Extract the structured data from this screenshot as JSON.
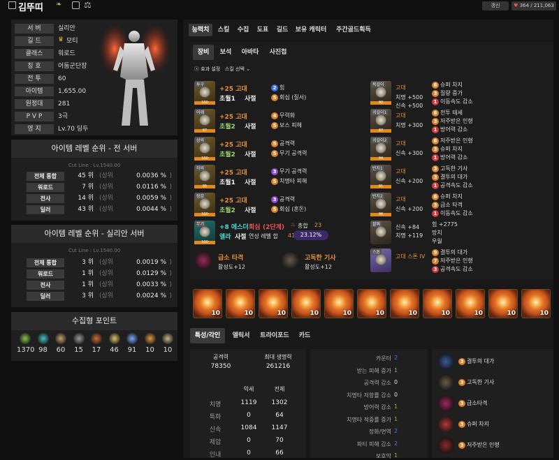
{
  "header": {
    "name": "김뚜띠",
    "update_label": "갱신",
    "likes": "364 / 211,063"
  },
  "profile": {
    "rows": [
      {
        "label": "서 버",
        "value": "실리안"
      },
      {
        "label": "길 드",
        "value": "모티"
      },
      {
        "label": "클래스",
        "value": "워로드"
      },
      {
        "label": "칭 호",
        "value": "어둠군단장"
      },
      {
        "label": "전 투",
        "value": "60"
      },
      {
        "label": "아이템",
        "value": "1,655.00"
      },
      {
        "label": "원정대",
        "value": "281"
      },
      {
        "label": "P V P",
        "value": "3극"
      },
      {
        "label": "영 지",
        "value": "Lv.70 딩두"
      }
    ]
  },
  "rank_all": {
    "title": "아이템 레벨 순위 - 전 서버",
    "cutline": "Cut Line : Lv.1540.00",
    "rows": [
      {
        "label": "전체 통합",
        "rank": "45 위",
        "pct": "0.0036 %"
      },
      {
        "label": "워로드",
        "rank": "7 위",
        "pct": "0.0116 %"
      },
      {
        "label": "전사",
        "rank": "14 위",
        "pct": "0.0059 %"
      },
      {
        "label": "딜러",
        "rank": "43 위",
        "pct": "0.0044 %"
      }
    ]
  },
  "rank_server": {
    "title": "아이템 레벨 순위 - 실리안 서버",
    "cutline": "Cut Line : Lv.1540.00",
    "rows": [
      {
        "label": "전체 통합",
        "rank": "3 위",
        "pct": "0.0019 %"
      },
      {
        "label": "워로드",
        "rank": "1 위",
        "pct": "0.0129 %"
      },
      {
        "label": "전사",
        "rank": "1 위",
        "pct": "0.0033 %"
      },
      {
        "label": "딜러",
        "rank": "3 위",
        "pct": "0.0024 %"
      }
    ]
  },
  "rank_labels": {
    "upper": "(상위",
    "close": ")"
  },
  "collect": {
    "title": "수집형 포인트",
    "values": [
      "1370",
      "98",
      "60",
      "15",
      "17",
      "46",
      "91",
      "10",
      "10"
    ]
  },
  "tabs_main": [
    "능력치",
    "스킬",
    "수집",
    "도표",
    "길드",
    "보유 캐릭터",
    "주간골드획득"
  ],
  "tabs_equip": [
    "장비",
    "보석",
    "아바타",
    "사진첩"
  ],
  "equip_options": {
    "effect": "효과 설정",
    "skill_select": "스킬 선택"
  },
  "armor": [
    {
      "cat": "투구",
      "q": "100",
      "grade": "+25 고대",
      "elixir_grade": "초월1",
      "elixir": "사절",
      "s1n": "2",
      "s1": "힘",
      "s2n": "5",
      "s2": "회심 (질서)"
    },
    {
      "cat": "어깨",
      "q": "97",
      "grade": "+25 고대",
      "elixir_grade": "초월2",
      "elixir": "사절",
      "s1n": "4",
      "s1": "무력화",
      "s2n": "5",
      "s2": "보스 피해"
    },
    {
      "cat": "상의",
      "q": "100",
      "grade": "+25 고대",
      "elixir_grade": "초월2",
      "elixir": "사절",
      "s1n": "5",
      "s1": "공격력",
      "s2n": "5",
      "s2": "무기 공격력"
    },
    {
      "cat": "하의",
      "q": "95",
      "grade": "+25 고대",
      "elixir_grade": "초월1",
      "elixir": "사절",
      "s1n": "3",
      "s1": "무기 공격력",
      "s2n": "5",
      "s2": "치명타 피해"
    },
    {
      "cat": "장갑",
      "q": "100",
      "grade": "+25 고대",
      "elixir_grade": "초월2",
      "elixir": "사절",
      "s1n": "3",
      "s1": "공격력",
      "s2n": "5",
      "s2": "회심 (혼돈)"
    }
  ],
  "weapon": {
    "cat": "무기",
    "q": "100",
    "grade": "+8 에스더",
    "name": "엘라",
    "name_suffix": "사절",
    "crit_label": "회심",
    "crit_stage": "(2단계)",
    "total_label": "총합",
    "total": "23",
    "yeon_label": "연성 레벨 합",
    "yeon": "41",
    "pct": "23.12%"
  },
  "engr_featured": [
    {
      "name": "급소 타격",
      "level": "활성도+12"
    },
    {
      "name": "고독한 기사",
      "level": "활성도+12"
    }
  ],
  "acc": [
    {
      "cat": "목걸이",
      "q": "90",
      "grade": "고대",
      "stats": [
        "치명 +500",
        "신속 +500"
      ],
      "effects": [
        {
          "n": "6",
          "t": "슈퍼 차지"
        },
        {
          "n": "3",
          "t": "질량 증가"
        },
        {
          "n": "1",
          "t": "이동속도 감소"
        }
      ]
    },
    {
      "cat": "귀걸이1",
      "q": "87",
      "grade": "고대",
      "stats": [
        "치명 +300"
      ],
      "effects": [
        {
          "n": "6",
          "t": "전투 태세"
        },
        {
          "n": "3",
          "t": "저주받은 인형"
        },
        {
          "n": "1",
          "t": "방어력 감소"
        }
      ]
    },
    {
      "cat": "귀걸이2",
      "q": "94",
      "grade": "고대",
      "stats": [
        "신속 +300"
      ],
      "effects": [
        {
          "n": "6",
          "t": "저주받은 인형"
        },
        {
          "n": "3",
          "t": "슈퍼 차지"
        },
        {
          "n": "1",
          "t": "방어력 감소"
        }
      ]
    },
    {
      "cat": "반지1",
      "q": "91",
      "grade": "고대",
      "stats": [
        "신속 +200"
      ],
      "effects": [
        {
          "n": "3",
          "t": "고독한 기사"
        },
        {
          "n": "3",
          "t": "결투의 대가"
        },
        {
          "n": "1",
          "t": "공격속도 감소"
        }
      ]
    },
    {
      "cat": "반지2",
      "q": "96",
      "grade": "고대",
      "stats": [
        "신속 +200"
      ],
      "effects": [
        {
          "n": "6",
          "t": "슈퍼 차지"
        },
        {
          "n": "3",
          "t": "급소 타격"
        },
        {
          "n": "1",
          "t": "이동속도 감소"
        }
      ]
    },
    {
      "cat": "팔찌",
      "q": "",
      "grade": "",
      "stats": [
        "신속 +84",
        "치명 +119"
      ],
      "effects": [
        {
          "n": "",
          "t": "힘 +2775"
        },
        {
          "n": "",
          "t": "망치"
        },
        {
          "n": "",
          "t": "우월"
        }
      ]
    },
    {
      "cat": "스톤",
      "q": "",
      "grade": "고대 스톤 IV",
      "stats": [],
      "effects": [
        {
          "n": "9",
          "t": "결투의 대가"
        },
        {
          "n": "7",
          "t": "저주받은 인형"
        },
        {
          "n": "3",
          "t": "공격속도 감소"
        }
      ]
    }
  ],
  "gems": {
    "level": "10",
    "count": 11
  },
  "tabs_lower": [
    "특성/각인",
    "엘릭서",
    "트라이포드",
    "카드"
  ],
  "stats": {
    "atk_label": "공격력",
    "atk": "78350",
    "hp_label": "최대 생명력",
    "hp": "261216",
    "col_a": "악세",
    "col_b": "전체",
    "rows": [
      {
        "label": "치명",
        "a": "1119",
        "b": "1302"
      },
      {
        "label": "특화",
        "a": "0",
        "b": "64"
      },
      {
        "label": "신속",
        "a": "1084",
        "b": "1147"
      },
      {
        "label": "제압",
        "a": "0",
        "b": "70"
      },
      {
        "label": "인내",
        "a": "0",
        "b": "66"
      }
    ]
  },
  "battle": [
    {
      "label": "카운터",
      "v": "2",
      "c": "#4a7fe0"
    },
    {
      "label": "받는 피해 증가",
      "v": "1",
      "c": "#8ab840"
    },
    {
      "label": "공격력 감소",
      "v": "0",
      "c": "#ddd"
    },
    {
      "label": "치명타 저항률 감소",
      "v": "0",
      "c": "#ddd"
    },
    {
      "label": "방어력 감소",
      "v": "1",
      "c": "#8ab840"
    },
    {
      "label": "치명타 적중률 증가",
      "v": "1",
      "c": "#8ab840"
    },
    {
      "label": "정화/면역",
      "v": "2",
      "c": "#4a7fe0"
    },
    {
      "label": "파티 피해 감소",
      "v": "2",
      "c": "#4a7fe0"
    },
    {
      "label": "보호막",
      "v": "1",
      "c": "#8ab840"
    }
  ],
  "engravings": [
    {
      "n": "3",
      "t": "결투의 대가"
    },
    {
      "n": "3",
      "t": "고독한 기사"
    },
    {
      "n": "3",
      "t": "급소타격"
    },
    {
      "n": "3",
      "t": "슈퍼 차지"
    },
    {
      "n": "3",
      "t": "저주받은 인형"
    }
  ],
  "colors": {
    "accent_orange": "#d9822b",
    "accent_blue": "#3a6fd9",
    "accent_purple": "#8a4bd1",
    "red": "#d13b3b"
  }
}
